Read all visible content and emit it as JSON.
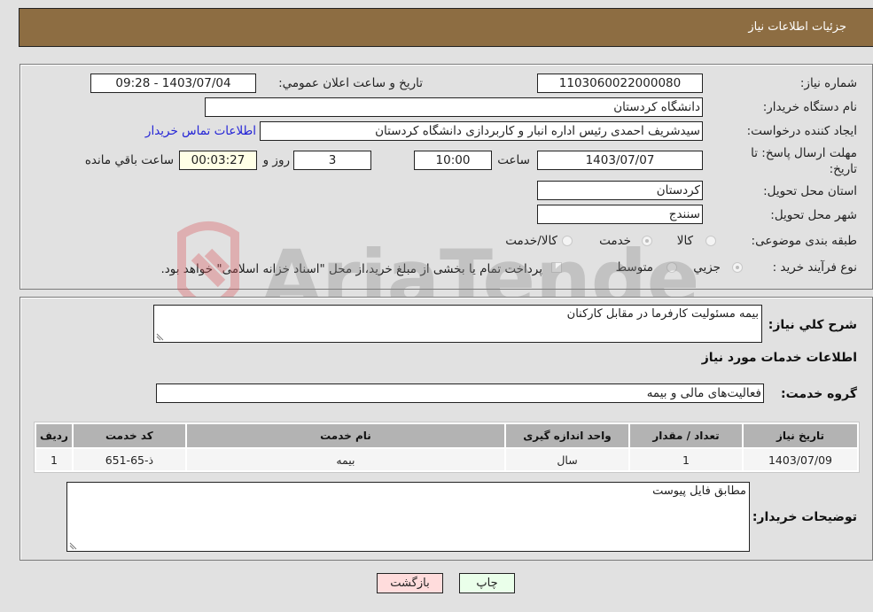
{
  "header": {
    "title": "جزئیات اطلاعات نیاز"
  },
  "form": {
    "need_number": {
      "label": "شماره نیاز:",
      "value": "1103060022000080"
    },
    "announce_datetime": {
      "label": "تاریخ و ساعت اعلان عمومي:",
      "value": "1403/07/04 - 09:28"
    },
    "buyer_org": {
      "label": "نام دستگاه خریدار:",
      "value": "دانشگاه کردستان"
    },
    "requester": {
      "label": "ایجاد کننده درخواست:",
      "value": "سیدشریف احمدی رئیس اداره انبار و کاربردازی دانشگاه کردستان"
    },
    "buyer_contact_link": "اطلاعات تماس خریدار",
    "deadline": {
      "label_line1": "مهلت ارسال پاسخ: تا",
      "label_line2": "تاریخ:",
      "date": "1403/07/07",
      "time_label": "ساعت",
      "time": "10:00",
      "days": "3",
      "days_label": "روز و",
      "remaining": "00:03:27",
      "remaining_label": "ساعت باقي مانده"
    },
    "delivery_province": {
      "label": "استان محل تحویل:",
      "value": "کردستان"
    },
    "delivery_city": {
      "label": "شهر محل تحویل:",
      "value": "سنندج"
    },
    "category": {
      "label": "طبقه بندی موضوعی:",
      "options": [
        "کالا",
        "خدمت",
        "کالا/خدمت"
      ],
      "selected": "خدمت"
    },
    "purchase_type": {
      "label": "نوع فرآیند خرید :",
      "options": [
        "جزیي",
        "متوسط"
      ],
      "selected": "جزیي",
      "treasury_note": "پرداخت تمام یا بخشی از مبلغ خرید،از محل \"اسناد خزانه اسلامی\" خواهد بود."
    }
  },
  "details": {
    "general_desc_label": "شرح کلي نیاز:",
    "general_desc_value": "بیمه مسئولیت کارفرما در مقابل کارکنان",
    "services_title": "اطلاعات خدمات مورد نیاز",
    "service_group_label": "گروه خدمت:",
    "service_group_value": "فعالیت‌های مالی و بیمه",
    "table": {
      "headers": [
        "ردیف",
        "کد خدمت",
        "نام خدمت",
        "واحد اندازه گیری",
        "تعداد / مقدار",
        "تاریخ نیاز"
      ],
      "rows": [
        [
          "1",
          "ذ-65-651",
          "بیمه",
          "سال",
          "1",
          "1403/07/09"
        ]
      ]
    },
    "buyer_notes_label": "توضیحات خریدار:",
    "buyer_notes_value": "مطابق فایل پیوست"
  },
  "buttons": {
    "print": "چاپ",
    "back": "بازگشت"
  },
  "watermark": {
    "text": "AriaTender.neT"
  },
  "colors": {
    "header_bg": "#8d6d42",
    "print_bg": "#eaffea",
    "back_bg": "#ffdcdc",
    "link": "#2323d6"
  }
}
